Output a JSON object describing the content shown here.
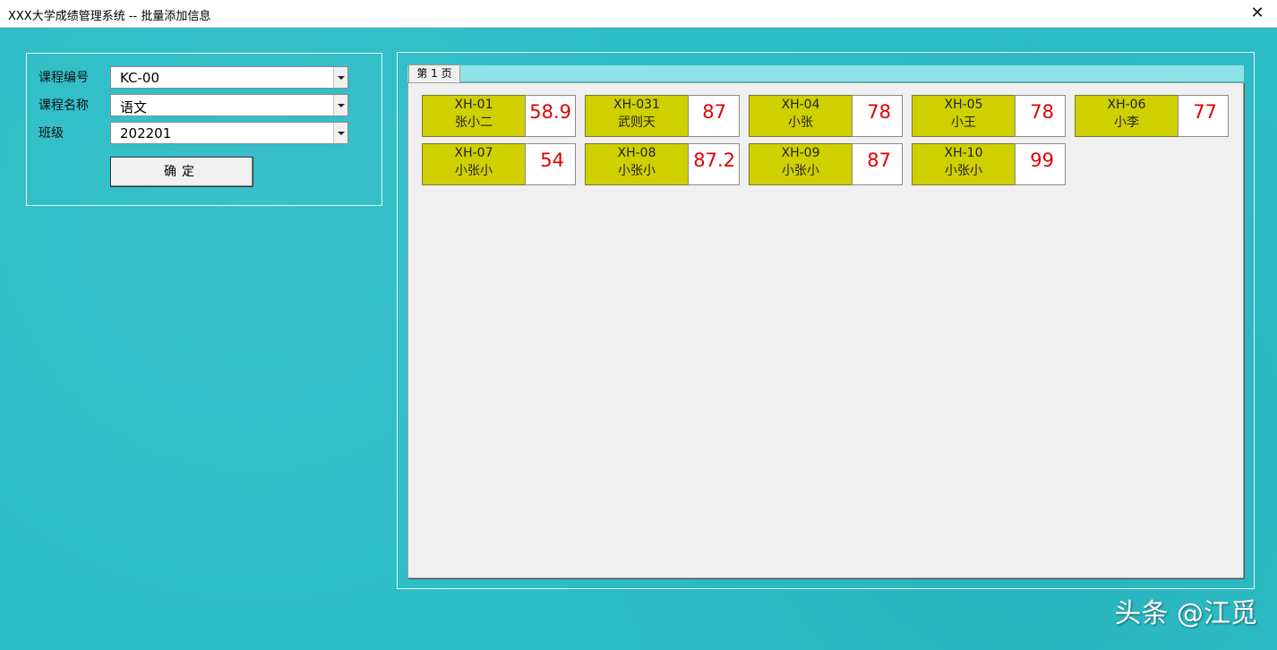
{
  "window": {
    "title": "XXX大学成绩管理系统 -- 批量添加信息",
    "close": "✕"
  },
  "form": {
    "course_code_label": "课程编号",
    "course_code_value": "KC-00",
    "course_name_label": "课程名称",
    "course_name_value": "语文",
    "class_label": "班级",
    "class_value": "202201",
    "confirm_label": "确定"
  },
  "tabs": [
    {
      "label": "第 1 页"
    }
  ],
  "students": [
    {
      "id": "XH-01",
      "name": "张小二",
      "score": "58.9"
    },
    {
      "id": "XH-031",
      "name": "武则天",
      "score": "87"
    },
    {
      "id": "XH-04",
      "name": "小张",
      "score": "78"
    },
    {
      "id": "XH-05",
      "name": "小王",
      "score": "78"
    },
    {
      "id": "XH-06",
      "name": "小李",
      "score": "77"
    },
    {
      "id": "XH-07",
      "name": "小张小",
      "score": "54"
    },
    {
      "id": "XH-08",
      "name": "小张小",
      "score": "87.2"
    },
    {
      "id": "XH-09",
      "name": "小张小",
      "score": "87"
    },
    {
      "id": "XH-10",
      "name": "小张小",
      "score": "99"
    }
  ],
  "watermark": "头条 @江觅"
}
